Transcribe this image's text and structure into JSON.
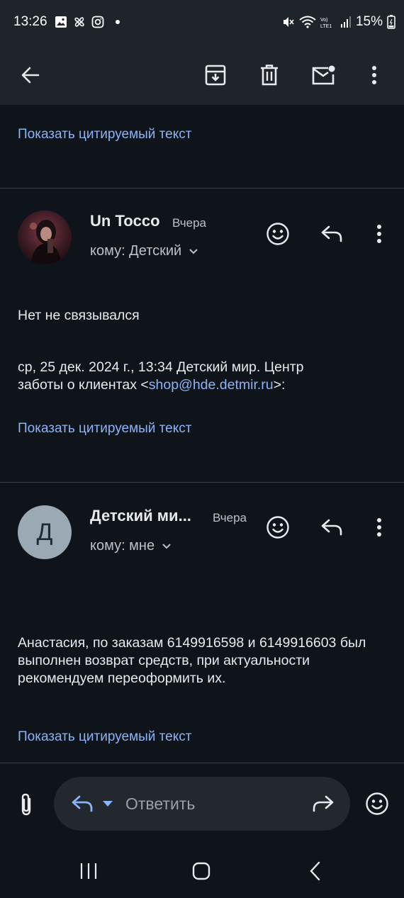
{
  "status_bar": {
    "time": "13:26",
    "battery": "15%",
    "icons": [
      "gallery-icon",
      "fan-icon",
      "instagram-icon",
      "notification-dot",
      "mute-icon",
      "wifi-icon",
      "volte-icon",
      "signal-icon",
      "battery-icon"
    ]
  },
  "toolbar": {
    "icons": [
      "back-arrow-icon",
      "archive-icon",
      "trash-icon",
      "mark-unread-icon",
      "more-vert-icon"
    ]
  },
  "top_quoted_link": "Показать цитируемый текст",
  "messages": [
    {
      "sender": "Un Tocco",
      "date": "Вчера",
      "recipient": "кому: Детский",
      "body_line1": "Нет не связывался",
      "quote_header_part1": "ср, 25 дек. 2024 г., 13:34 Детский мир. Центр заботы о клиентах <",
      "quote_email": "shop@hde.detmir.ru",
      "quote_header_part2": ">:",
      "quoted_link": "Показать цитируемый текст"
    },
    {
      "sender": "Детский ми...",
      "avatar_letter": "Д",
      "date": "Вчера",
      "recipient": "кому: мне",
      "body": "Анастасия, по заказам 6149916598 и 6149916603 был выполнен возврат средств, при актуальности рекомендуем переоформить их.",
      "quoted_link": "Показать цитируемый текст"
    }
  ],
  "reply_bar": {
    "placeholder": "Ответить"
  },
  "colors": {
    "background": "#0f131a",
    "toolbar": "#1f232a",
    "link": "#8ab4f8",
    "avatar_letter_bg": "#9aa9b4"
  }
}
